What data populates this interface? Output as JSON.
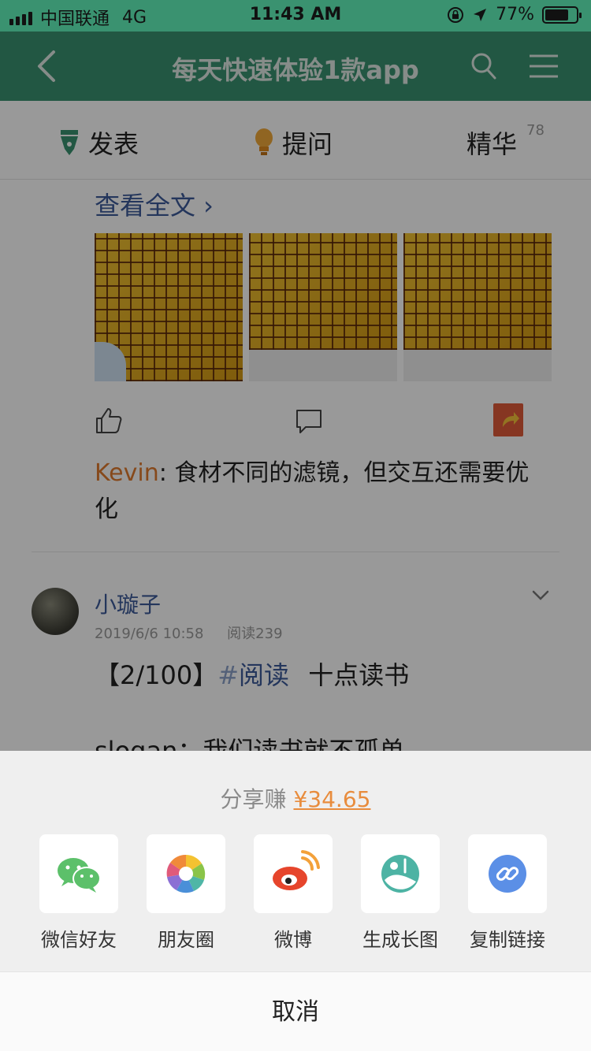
{
  "status_bar": {
    "carrier": "中国联通",
    "network": "4G",
    "time": "11:43 AM",
    "battery_percent": "77%",
    "battery_level": 0.77
  },
  "nav": {
    "title": "每天快速体验1款app",
    "icons": [
      "back-chevron-icon",
      "search-icon",
      "menu-icon"
    ]
  },
  "tabs": [
    {
      "label": "发表",
      "icon": "pen-icon"
    },
    {
      "label": "提问",
      "icon": "lightbulb-icon"
    },
    {
      "label": "精华",
      "count": "78"
    }
  ],
  "feed": {
    "read_more": "查看全文 ›",
    "reactions": [
      "like-icon",
      "comment-icon",
      "share-icon"
    ],
    "comment": {
      "user": "Kevin",
      "text": ": 食材不同的滤镜，但交互还需要优化"
    },
    "post": {
      "author": "小璇子",
      "date": "2019/6/6 10:58",
      "reads": "阅读239",
      "title_prefix": "【2/100】",
      "topic_hash": "#",
      "topic": "阅读",
      "title_suffix": "十点读书",
      "line2": "slogan：我们读书就不孤单"
    }
  },
  "share_sheet": {
    "header_prefix": "分享赚",
    "amount": "¥34.65",
    "options": [
      {
        "label": "微信好友",
        "icon": "wechat-icon"
      },
      {
        "label": "朋友圈",
        "icon": "moments-icon"
      },
      {
        "label": "微博",
        "icon": "weibo-icon"
      },
      {
        "label": "生成长图",
        "icon": "long-image-icon"
      },
      {
        "label": "复制链接",
        "icon": "link-icon"
      }
    ],
    "cancel": "取消"
  },
  "colors": {
    "nav_green": "#3a9270",
    "link_blue": "#3c5a9a",
    "accent_orange": "#e88c3d"
  }
}
